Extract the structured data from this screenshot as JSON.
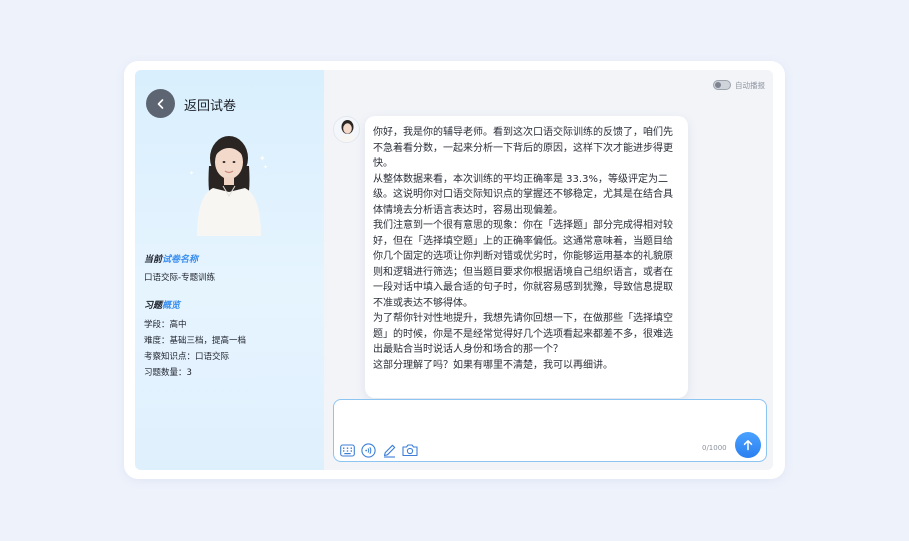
{
  "header": {
    "back_title": "返回试卷"
  },
  "paper": {
    "heading_part1": "当前",
    "heading_part2": "试卷名称",
    "name": "口语交际-专题训练"
  },
  "overview": {
    "heading_part1": "习题",
    "heading_part2": "概览",
    "items": [
      "学段：高中",
      "难度：基础三档，提高一档",
      "考察知识点：口语交际",
      "习题数量：3"
    ]
  },
  "autoplay": {
    "label": "自动播报",
    "enabled": false
  },
  "chat": {
    "message_paragraphs": [
      "你好，我是你的辅导老师。看到这次口语交际训练的反馈了，咱们先不急着看分数，一起来分析一下背后的原因，这样下次才能进步得更快。",
      "从整体数据来看，本次训练的平均正确率是 33.3%，等级评定为二级。这说明你对口语交际知识点的掌握还不够稳定，尤其是在结合具体情境去分析语言表达时，容易出现偏差。",
      "我们注意到一个很有意思的现象：你在「选择题」部分完成得相对较好，但在「选择填空题」上的正确率偏低。这通常意味着，当题目给你几个固定的选项让你判断对错或优劣时，你能够运用基本的礼貌原则和逻辑进行筛选；但当题目要求你根据语境自己组织语言，或者在一段对话中填入最合适的句子时，你就容易感到犹豫，导致信息提取不准或表达不够得体。",
      "为了帮你针对性地提升，我想先请你回想一下，在做那些「选择填空题」的时候，你是不是经常觉得好几个选项看起来都差不多，很难选出最贴合当时说话人身份和场合的那一个？",
      "这部分理解了吗？如果有哪里不清楚，我可以再细讲。"
    ]
  },
  "input": {
    "value": "",
    "counter": "0/1000"
  },
  "icons": {
    "back": "chevron-left-icon",
    "keyboard": "keyboard-icon",
    "voice": "voice-icon",
    "pen": "pen-icon",
    "camera": "camera-icon",
    "send": "arrow-up-icon"
  },
  "colors": {
    "accent": "#3a8ef0",
    "send": "#2b7ff0",
    "panel": "#dff0fd"
  }
}
